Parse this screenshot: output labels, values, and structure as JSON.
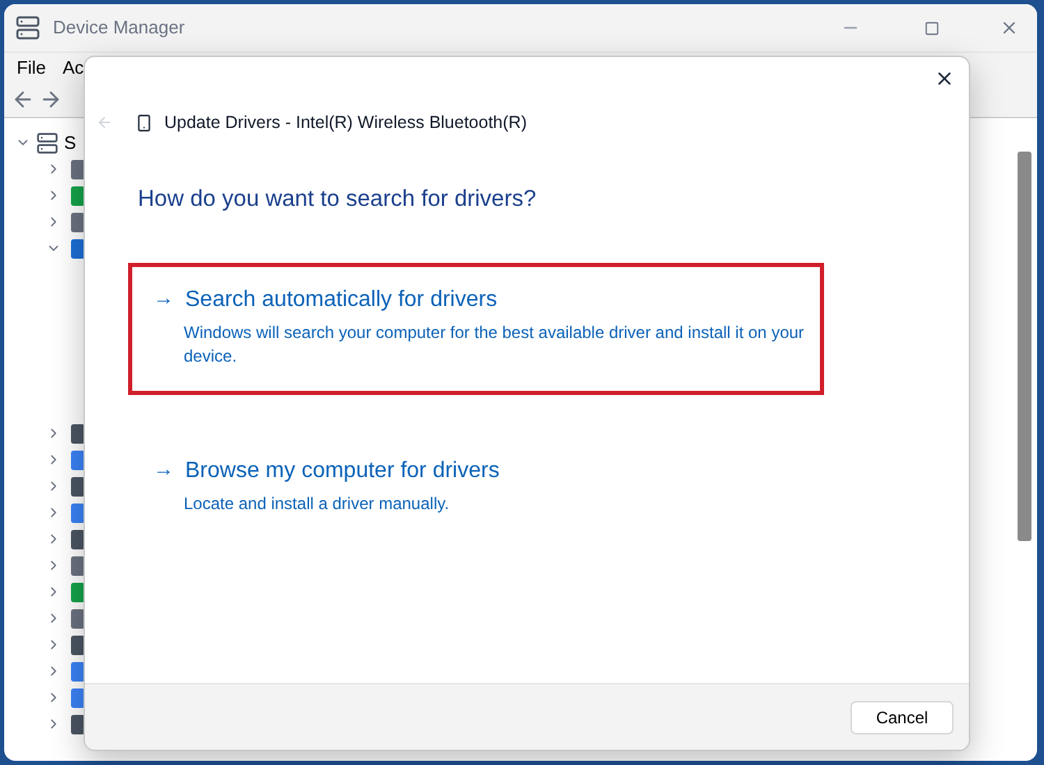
{
  "window": {
    "title": "Device Manager"
  },
  "menu": [
    "File",
    "Ac"
  ],
  "tree": {
    "label": "S",
    "expanded": true,
    "children": [
      {
        "expanded": false
      },
      {
        "expanded": false
      },
      {
        "expanded": false
      },
      {
        "expanded": true
      },
      {
        "expanded": false
      },
      {
        "expanded": false
      },
      {
        "expanded": false
      },
      {
        "expanded": false
      },
      {
        "expanded": false
      },
      {
        "expanded": false
      },
      {
        "expanded": false
      },
      {
        "expanded": false
      },
      {
        "expanded": false
      },
      {
        "expanded": false
      },
      {
        "expanded": false
      },
      {
        "expanded": false
      }
    ]
  },
  "dialog": {
    "title": "Update Drivers - Intel(R) Wireless Bluetooth(R)",
    "heading": "How do you want to search for drivers?",
    "options": [
      {
        "arrow": "→",
        "title": "Search automatically for drivers",
        "description": "Windows will search your computer for the best available driver and install it on your device.",
        "highlighted": true
      },
      {
        "arrow": "→",
        "title": "Browse my computer for drivers",
        "description": "Locate and install a driver manually.",
        "highlighted": false
      }
    ],
    "buttons": [
      "Cancel"
    ]
  }
}
